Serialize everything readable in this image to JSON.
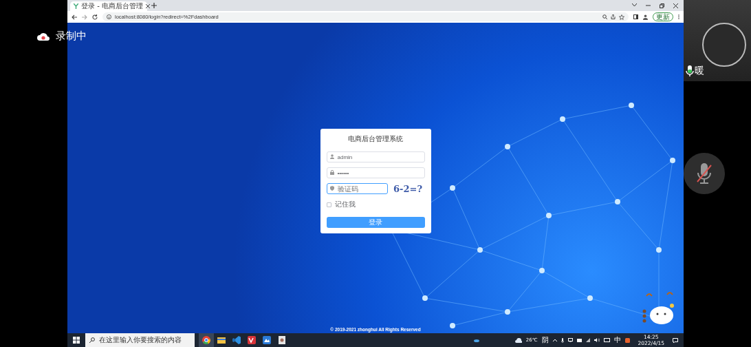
{
  "recording": {
    "label": "录制中"
  },
  "browser": {
    "tabs": [
      {
        "title": "登录 - 电商后台管理",
        "selected": true
      }
    ],
    "address": "localhost:8080/login?redirect=%2Fdashboard",
    "update_button": "更新"
  },
  "login": {
    "title": "电商后台管理系统",
    "username": {
      "value": "admin"
    },
    "password": {
      "value": "••••••"
    },
    "captcha": {
      "placeholder": "验证码",
      "focused": true,
      "image_text": "6-2=?"
    },
    "remember": {
      "label": "记住我",
      "checked": false
    },
    "submit": "登录"
  },
  "footer": "© 2019-2021 zhonghui All Rights Reserved",
  "taskbar": {
    "search_placeholder": "在这里输入你要搜索的内容",
    "temperature": "26℃",
    "weather": "阴",
    "ime": "中",
    "time": "14:25",
    "date": "2022/4/15"
  },
  "participant": {
    "name": "暖",
    "mic_on": true
  },
  "mute_button": {
    "muted": true
  }
}
